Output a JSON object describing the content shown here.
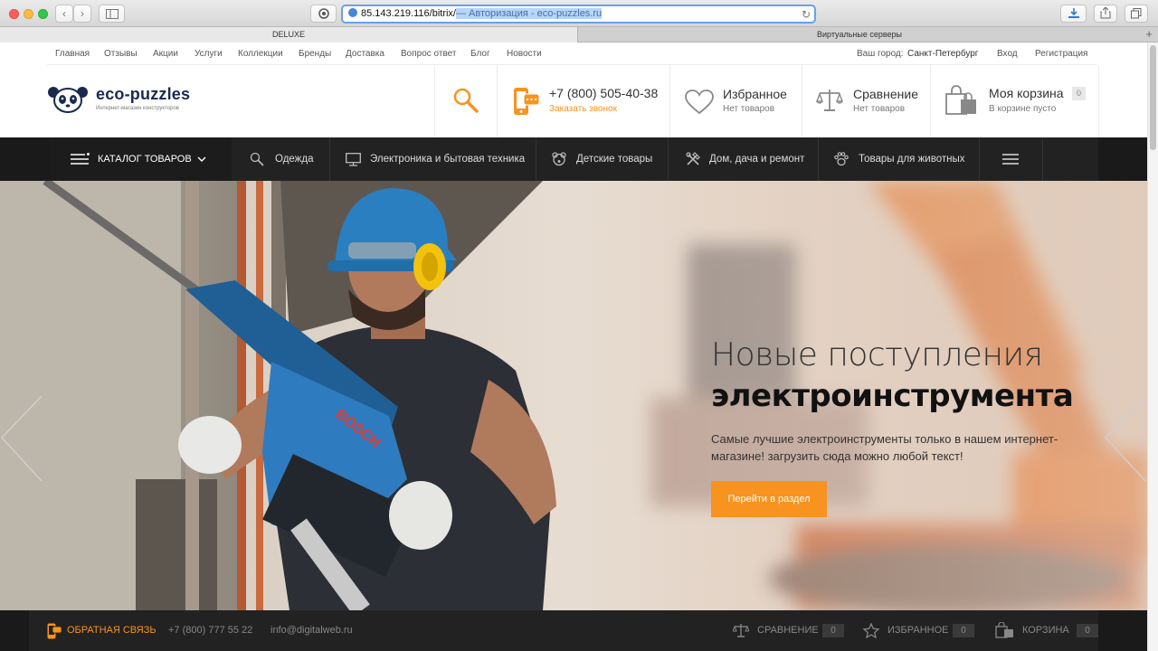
{
  "browser": {
    "url": "85.143.219.116/bitrix/",
    "title_suffix": "— Авторизация - eco-puzzles.ru",
    "tabs": [
      {
        "label": "DELUXE"
      },
      {
        "label": "Виртуальные серверы"
      }
    ],
    "new_tab_label": "+"
  },
  "topnav": {
    "links": [
      "Главная",
      "Отзывы",
      "Акции",
      "Услуги",
      "Коллекции",
      "Бренды",
      "Доставка",
      "Вопрос ответ",
      "Блог",
      "Новости"
    ],
    "city_label": "Ваш город:",
    "city": "Санкт-Петербург",
    "login": "Вход",
    "register": "Регистрация"
  },
  "header": {
    "logo_name": "eco-puzzles",
    "logo_tagline": "Интернет-магазин конструкторов",
    "phone": "+7 (800) 505-40-38",
    "callback": "Заказать звонок",
    "favorites_title": "Избранное",
    "favorites_sub": "Нет товаров",
    "compare_title": "Сравнение",
    "compare_sub": "Нет товаров",
    "cart_title": "Моя корзина",
    "cart_sub": "В корзине пусто",
    "cart_count": "0"
  },
  "mainnav": {
    "catalog": "КАТАЛОГ ТОВАРОВ",
    "items": [
      "Одежда",
      "Электроника и бытовая техника",
      "Детские товары",
      "Дом, дача и ремонт",
      "Товары для животных"
    ]
  },
  "hero": {
    "title_line1": "Новые поступления",
    "title_line2": "электроинструмента",
    "text": "Самые лучшие электроинструменты только в нашем интернет-магазине! загрузить сюда можно любой текст!",
    "button": "Перейти в раздел",
    "drill_brand": "BOSCH"
  },
  "footer": {
    "feedback": "ОБРАТНАЯ СВЯЗЬ",
    "phone": "+7 (800) 777 55 22",
    "email": "info@digitalweb.ru",
    "compare": "СРАВНЕНИЕ",
    "compare_count": "0",
    "favorites": "ИЗБРАННОЕ",
    "favorites_count": "0",
    "cart": "КОРЗИНА",
    "cart_count": "0"
  },
  "colors": {
    "accent": "#f7931e",
    "dark_nav": "#1a1a1a",
    "logo_navy": "#1a2a4f"
  }
}
